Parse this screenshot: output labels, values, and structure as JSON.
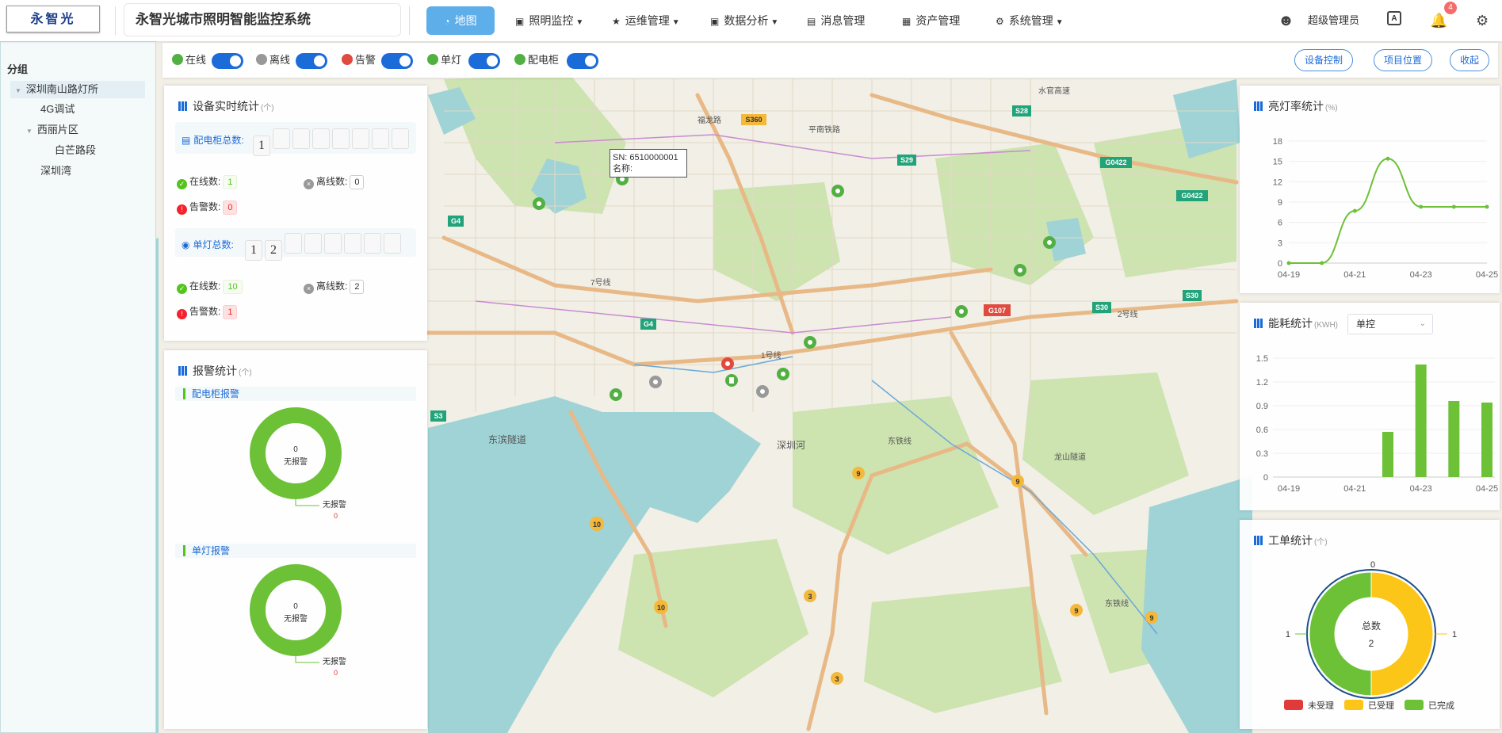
{
  "header": {
    "logo_text": "永智光",
    "title": "永智光城市照明智能监控系统",
    "nav": [
      {
        "label": "地图",
        "icon": "dashboard-icon",
        "active": true
      },
      {
        "label": "照明监控",
        "icon": "image-icon"
      },
      {
        "label": "运维管理",
        "icon": "star-icon"
      },
      {
        "label": "数据分析",
        "icon": "chart-icon"
      },
      {
        "label": "消息管理",
        "icon": "message-icon"
      },
      {
        "label": "资产管理",
        "icon": "table-icon"
      },
      {
        "label": "系统管理",
        "icon": "gear-icon"
      }
    ],
    "user_name": "超级管理员",
    "notification_count": "4"
  },
  "sidebar": {
    "title": "分组",
    "tree": [
      {
        "label": "深圳南山路灯所",
        "level": 0,
        "expanded": true
      },
      {
        "label": "4G调试",
        "level": 1
      },
      {
        "label": "西丽片区",
        "level": 1,
        "expanded": true
      },
      {
        "label": "白芒路段",
        "level": 2
      },
      {
        "label": "深圳湾",
        "level": 1
      }
    ]
  },
  "filters": {
    "items": [
      {
        "label": "在线",
        "color": "#52b043",
        "on": true
      },
      {
        "label": "离线",
        "color": "#999999",
        "on": true
      },
      {
        "label": "告警",
        "color": "#e04a3f",
        "on": true
      },
      {
        "label": "单灯",
        "color": "#52b043",
        "on": true
      },
      {
        "label": "配电柜",
        "color": "#52b043",
        "on": true
      }
    ],
    "buttons": [
      "设备控制",
      "项目位置",
      "收起"
    ]
  },
  "device_stats": {
    "title": "设备实时统计",
    "unit": "(个)",
    "cabinet": {
      "label": "配电柜总数:",
      "digits": [
        "1",
        "",
        "",
        "",
        "",
        "",
        "",
        ""
      ],
      "online_label": "在线数:",
      "online": "1",
      "offline_label": "离线数:",
      "offline": "0",
      "alarm_label": "告警数:",
      "alarm": "0"
    },
    "lamp": {
      "label": "单灯总数:",
      "digits": [
        "1",
        "2",
        "",
        "",
        "",
        "",
        "",
        ""
      ],
      "online_label": "在线数:",
      "online": "10",
      "offline_label": "离线数:",
      "offline": "2",
      "alarm_label": "告警数:",
      "alarm": "1"
    }
  },
  "alarm_stats": {
    "title": "报警统计",
    "unit": "(个)",
    "cabinet_section": "配电柜报警",
    "lamp_section": "单灯报警",
    "cabinet_chart": {
      "center_value": "0",
      "center_label": "无报警",
      "callout_label": "无报警",
      "callout_value": "0"
    },
    "lamp_chart": {
      "center_value": "0",
      "center_label": "无报警",
      "callout_label": "无报警",
      "callout_value": "0"
    }
  },
  "map": {
    "popup_sn": "SN: 6510000001",
    "popup_name": "名称:",
    "labels": [
      "S360",
      "S28",
      "S29",
      "G0422",
      "G0422",
      "G4",
      "G4",
      "S30",
      "S30",
      "G107",
      "S3",
      "9",
      "9",
      "9",
      "9",
      "10",
      "10",
      "3",
      "3",
      "东滨隧道",
      "深圳河",
      "东铁线",
      "平南铁路",
      "水官高速",
      "福龙路",
      "7号线",
      "1号线",
      "2号线",
      "龙山隧道",
      "东铁线"
    ]
  },
  "light_rate": {
    "title": "亮灯率统计",
    "unit": "(%)",
    "chart_data": {
      "type": "line",
      "x": [
        "04-19",
        "04-20",
        "04-21",
        "04-22",
        "04-23",
        "04-24",
        "04-25"
      ],
      "tick_labels": [
        "04-19",
        "04-21",
        "04-23",
        "04-25"
      ],
      "values": [
        0,
        0,
        7.7,
        15.4,
        8.3,
        8.3,
        8.3
      ],
      "point_labels": [
        "",
        "",
        "",
        "",
        "",
        "",
        ""
      ],
      "y_ticks": [
        "0",
        "3",
        "6",
        "9",
        "12",
        "15",
        "18"
      ],
      "ylim": [
        0,
        18
      ]
    }
  },
  "energy": {
    "title": "能耗统计",
    "unit": "(KWH)",
    "select_value": "单控",
    "chart_data": {
      "type": "bar",
      "categories": [
        "04-19",
        "04-20",
        "04-21",
        "04-22",
        "04-23",
        "04-24",
        "04-25"
      ],
      "tick_labels": [
        "04-19",
        "04-21",
        "04-23",
        "04-25"
      ],
      "values": [
        0,
        0,
        0,
        0.57,
        1.42,
        0.96,
        0.94
      ],
      "y_ticks": [
        "0",
        "0.3",
        "0.6",
        "0.9",
        "1.2",
        "1.5"
      ],
      "ylim": [
        0,
        1.5
      ]
    }
  },
  "work_orders": {
    "title": "工单统计",
    "unit": "(个)",
    "center_title": "总数",
    "center_value": "2",
    "chart_data": {
      "type": "pie",
      "labels": [
        "未受理",
        "已受理",
        "已完成"
      ],
      "values": [
        0,
        1,
        1
      ],
      "value_labels": [
        "0",
        "1",
        "1"
      ],
      "colors": [
        "#e03a3a",
        "#fcc618",
        "#6cc136"
      ]
    }
  }
}
